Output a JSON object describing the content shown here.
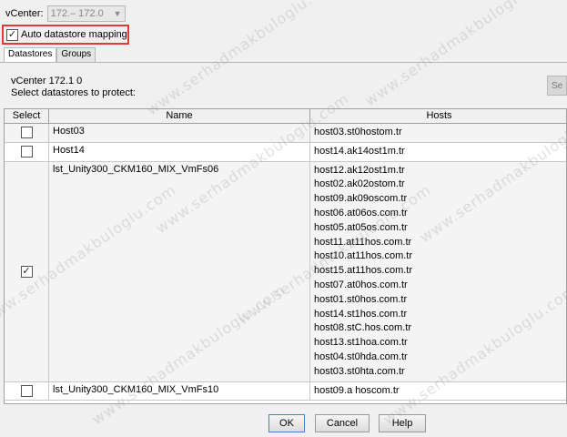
{
  "vcenter": {
    "label": "vCenter:",
    "selected": "172.– 172.0"
  },
  "auto_mapping": {
    "label": "Auto datastore mapping",
    "checked": true
  },
  "tabs": [
    {
      "label": "Datastores",
      "active": true
    },
    {
      "label": "Groups",
      "active": false
    }
  ],
  "panel": {
    "vcenter_line": "vCenter 172.1         0",
    "instruction": "Select datastores to protect:",
    "side_button": "Se"
  },
  "table": {
    "headers": {
      "select": "Select",
      "name": "Name",
      "hosts": "Hosts"
    },
    "rows": [
      {
        "checked": false,
        "name": "Host03",
        "hosts": [
          "host03.st0hostom.tr"
        ]
      },
      {
        "checked": false,
        "name": "Host14",
        "hosts": [
          "host14.ak14ost1m.tr"
        ]
      },
      {
        "checked": true,
        "name": "lst_Unity300_CKM160_MIX_VmFs06",
        "hosts": [
          "host12.ak12ost1m.tr",
          "host02.ak02ostom.tr",
          "host09.ak09oscom.tr",
          "host06.at06os.com.tr",
          "host05.at05os.com.tr",
          "host11.at11hos.com.tr",
          "host10.at11hos.com.tr",
          "host15.at11hos.com.tr",
          "host07.at0hos.com.tr",
          "host01.st0hos.com.tr",
          "host14.st1hos.com.tr",
          "host08.stC.hos.com.tr",
          "host13.st1hoa.com.tr",
          "host04.st0hda.com.tr",
          "host03.st0hta.com.tr"
        ]
      },
      {
        "checked": false,
        "name": "lst_Unity300_CKM160_MIX_VmFs10",
        "hosts": [
          "host09.a    hoscom.tr"
        ]
      }
    ]
  },
  "buttons": {
    "ok": "OK",
    "cancel": "Cancel",
    "help": "Help"
  },
  "watermark": "www.serhadmakbuloglu.com",
  "colors": {
    "highlight_border": "#e03b3b",
    "default_button_border": "#4a7fc1"
  }
}
